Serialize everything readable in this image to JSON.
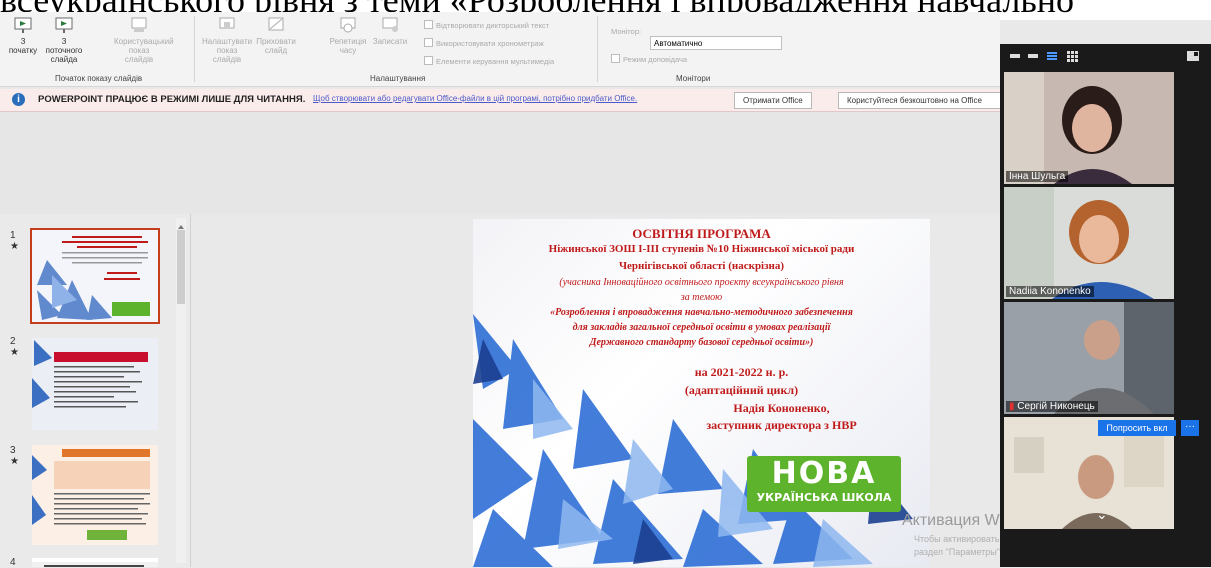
{
  "caption_fragment": "всеукраїнського рівня з теми «Розроблення і впровадження навчально",
  "ribbon": {
    "btn_from_start": "З початку",
    "btn_from_current": "З поточного слайда",
    "btn_custom_show": "Користувацький показ слайдів",
    "btn_setup": "Налаштувати показ слайдів",
    "btn_hide": "Приховати слайд",
    "btn_rehearse": "Репетиція часу",
    "btn_record": "Записати",
    "chk_play_narration": "Відтворювати дикторський текст",
    "chk_use_timings": "Використовувати хронометраж",
    "chk_show_media": "Елементи керування мультимедіа",
    "monitor_label": "Монітор:",
    "monitor_value": "Автоматично",
    "chk_presenter": "Режим доповідача",
    "group_start": "Початок показу слайдів",
    "group_setup": "Налаштування",
    "group_monitors": "Монітори"
  },
  "infobar": {
    "bold": "POWERPOINT ПРАЦЮЄ В РЕЖИМІ ЛИШЕ ДЛЯ ЧИТАННЯ.",
    "link": "Щоб створювати або редагувати Office-файли в цій програмі, потрібно придбати Office.",
    "btn_get": "Отримати Office",
    "btn_free": "Користуйтеся безкоштовно на Office"
  },
  "thumbnails": [
    {
      "num": "1",
      "marker": "★"
    },
    {
      "num": "2",
      "marker": "★"
    },
    {
      "num": "3",
      "marker": "★"
    },
    {
      "num": "4",
      "marker": ""
    }
  ],
  "slide": {
    "line1": "ОСВІТНЯ ПРОГРАМА",
    "line2": "Ніжинської ЗОШ І-ІІІ ступенів №10 Ніжинської міської ради",
    "line3": "Чернігівської області (наскрізна)",
    "line4": "(учасника Інноваційного освітнього проєкту всеукраїнського рівня",
    "line5": "за темою",
    "line6": "«Розроблення і впровадження навчально-методичного забезпечення",
    "line7": "для закладів загальної середньої освіти в умовах реалізації",
    "line8": "Державного стандарту базової середньої освіти»)",
    "line9": "на 2021-2022 н. р.",
    "line10": "(адаптаційний цикл)",
    "line11": "Надія Кононенко,",
    "line12": "заступник директора з НВР",
    "logo_big": "НОВА",
    "logo_small": "УКРАЇНСЬКА ШКОЛА"
  },
  "watermark": {
    "title": "Активация Windows",
    "line1": "Чтобы активировать Windows, перейдите в",
    "line2": "раздел \"Параметры\"."
  },
  "participants": [
    {
      "name": "Інна Шульга"
    },
    {
      "name": "Nadiia Kononenko"
    },
    {
      "name": "Сергій Никонець"
    },
    {
      "name": ""
    }
  ],
  "video": {
    "ask_button": "Попросить вкл",
    "more_button": "···",
    "collapse": "⌄"
  }
}
